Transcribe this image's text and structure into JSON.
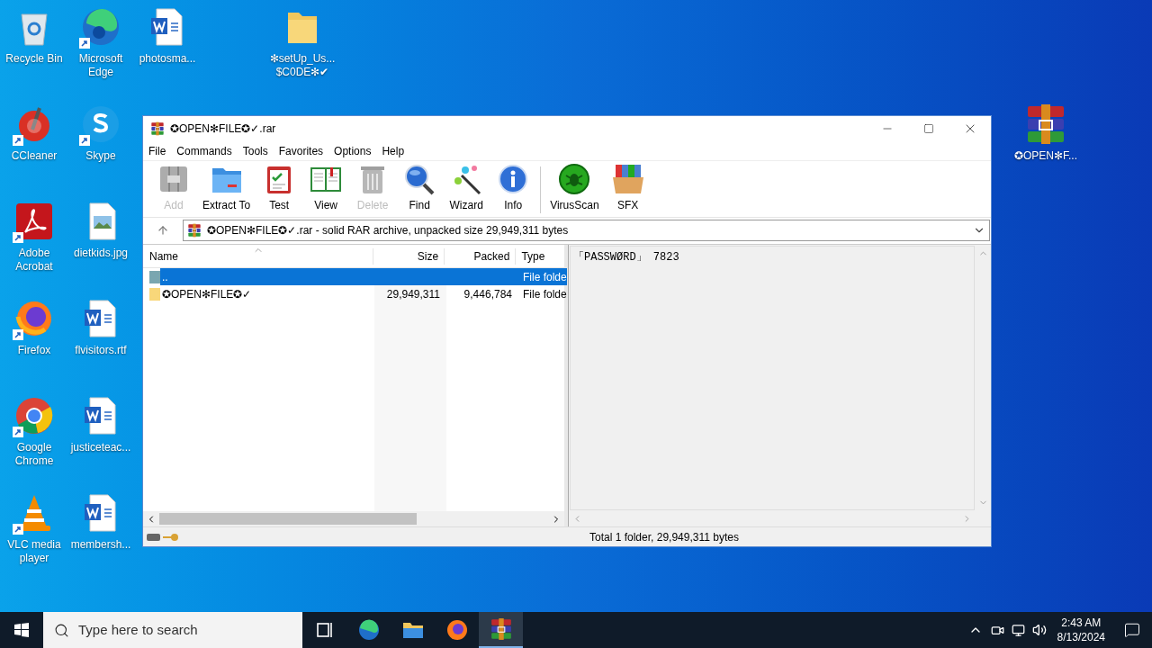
{
  "desktop_icons": [
    {
      "label": "Recycle Bin",
      "kind": "recycle"
    },
    {
      "label": "Microsoft Edge",
      "kind": "edge",
      "shortcut": true
    },
    {
      "label": "photosma...",
      "kind": "word"
    },
    {
      "label": "✻setUp_Us... $C0DE✻✔",
      "kind": "folder"
    },
    {
      "label": "CCleaner",
      "kind": "ccleaner",
      "shortcut": true
    },
    {
      "label": "Skype",
      "kind": "skype",
      "shortcut": true
    },
    {
      "label": "✪OPEN✻F...",
      "kind": "winrar"
    },
    {
      "label": "Adobe Acrobat",
      "kind": "pdf",
      "shortcut": true
    },
    {
      "label": "dietkids.jpg",
      "kind": "image"
    },
    {
      "label": "Firefox",
      "kind": "firefox",
      "shortcut": true
    },
    {
      "label": "flvisitors.rtf",
      "kind": "word"
    },
    {
      "label": "Google Chrome",
      "kind": "chrome",
      "shortcut": true
    },
    {
      "label": "justiceteac...",
      "kind": "word"
    },
    {
      "label": "VLC media player",
      "kind": "vlc",
      "shortcut": true
    },
    {
      "label": "membersh...",
      "kind": "word"
    }
  ],
  "window": {
    "title": "✪OPEN✻FILE✪✓.rar",
    "menu": [
      "File",
      "Commands",
      "Tools",
      "Favorites",
      "Options",
      "Help"
    ],
    "toolbar": [
      {
        "label": "Add",
        "kind": "add",
        "disabled": true
      },
      {
        "label": "Extract To",
        "kind": "extract",
        "disabled": false
      },
      {
        "label": "Test",
        "kind": "test",
        "disabled": false
      },
      {
        "label": "View",
        "kind": "view",
        "disabled": false
      },
      {
        "label": "Delete",
        "kind": "delete",
        "disabled": true
      },
      {
        "label": "Find",
        "kind": "find",
        "disabled": false
      },
      {
        "label": "Wizard",
        "kind": "wizard",
        "disabled": false
      },
      {
        "label": "Info",
        "kind": "info",
        "disabled": false
      },
      {
        "label": "VirusScan",
        "kind": "virus",
        "disabled": false
      },
      {
        "label": "SFX",
        "kind": "sfx",
        "disabled": false
      }
    ],
    "address": "✪OPEN✻FILE✪✓.rar - solid RAR archive, unpacked size 29,949,311 bytes",
    "columns": [
      "Name",
      "Size",
      "Packed",
      "Type"
    ],
    "rows": [
      {
        "name": "..",
        "size": "",
        "packed": "",
        "type": "File folde",
        "kind": "up",
        "selected": true
      },
      {
        "name": "✪OPEN✻FILE✪✓",
        "size": "29,949,311",
        "packed": "9,446,784",
        "type": "File folde",
        "kind": "folder",
        "selected": false
      }
    ],
    "comment": "「PASSWØRD」 7823",
    "status": "Total 1 folder, 29,949,311 bytes"
  },
  "taskbar": {
    "search_placeholder": "Type here to search",
    "apps": [
      {
        "kind": "taskview",
        "selected": false
      },
      {
        "kind": "edge",
        "selected": false
      },
      {
        "kind": "explorer",
        "selected": false
      },
      {
        "kind": "firefox",
        "selected": false
      },
      {
        "kind": "winrar",
        "selected": true
      }
    ],
    "time": "2:43 AM",
    "date": "8/13/2024"
  }
}
